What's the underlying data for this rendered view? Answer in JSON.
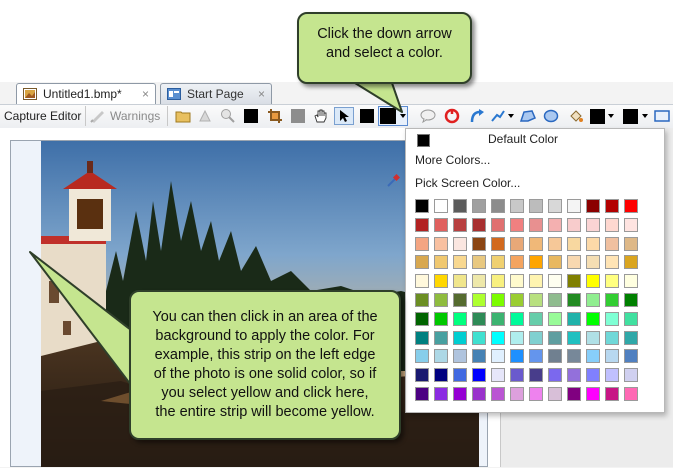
{
  "tabs": [
    {
      "label": "Untitled1.bmp*",
      "close": "×"
    },
    {
      "label": "Start Page",
      "close": "×"
    }
  ],
  "toolbar": {
    "capture_editor": "Capture Editor",
    "warnings": "Warnings",
    "fill_color": "#000000"
  },
  "menu": {
    "default_color": "Default Color",
    "more_colors": "More Colors...",
    "pick_screen_color": "Pick Screen Color..."
  },
  "palette": [
    "#000000",
    "#ffffff",
    "#5c5c5c",
    "#a0a0a0",
    "#8c8c8c",
    "#c8c8c8",
    "#bcbcbc",
    "#d8d8d8",
    "#f4f4f4",
    "#8b0000",
    "#b30000",
    "#ff0000",
    "#b22222",
    "#e0605e",
    "#b84040",
    "#a83030",
    "#e07070",
    "#f08080",
    "#e89090",
    "#f4b0b0",
    "#f8cccc",
    "#fad4d4",
    "#ffd8d0",
    "#ffe4e1",
    "#f4a582",
    "#f8c0a0",
    "#fae6e0",
    "#8b4513",
    "#d2691e",
    "#e8a878",
    "#f0b878",
    "#f6c898",
    "#f8d8a0",
    "#fcd9a8",
    "#f0c0a0",
    "#deb887",
    "#d8a850",
    "#f0c870",
    "#f8d890",
    "#e8c880",
    "#f0d070",
    "#f4a460",
    "#ffa500",
    "#e8b860",
    "#f8d8b0",
    "#f5deb3",
    "#ffe4b5",
    "#daa520",
    "#fff8dc",
    "#ffd700",
    "#f0e68c",
    "#eee8aa",
    "#f8f080",
    "#fffacd",
    "#fff4b0",
    "#fffff0",
    "#808000",
    "#ffff00",
    "#ffff80",
    "#ffffe0",
    "#6b8e23",
    "#8fbc3f",
    "#556b2f",
    "#adff2f",
    "#7cfc00",
    "#9acd32",
    "#b8e080",
    "#8fbc8f",
    "#228b22",
    "#90ee90",
    "#32cd32",
    "#008000",
    "#006400",
    "#00c800",
    "#00ff7f",
    "#2e8b57",
    "#3cb371",
    "#00fa9a",
    "#66cdaa",
    "#98fb98",
    "#20b2aa",
    "#00ff00",
    "#7fffd4",
    "#40e0a0",
    "#008080",
    "#48a0a0",
    "#00ced1",
    "#40e0d0",
    "#00ffff",
    "#afeeee",
    "#80d0d0",
    "#5f9ea0",
    "#20c0c0",
    "#b0e0e6",
    "#70d8d8",
    "#30a8a8",
    "#87ceeb",
    "#add8e6",
    "#b0c4de",
    "#4682b4",
    "#e0f0ff",
    "#1e90ff",
    "#6495ed",
    "#708090",
    "#778899",
    "#87cefa",
    "#b8d8f0",
    "#5080c0",
    "#191970",
    "#000080",
    "#4169e1",
    "#0000ff",
    "#e6e6fa",
    "#6a5acd",
    "#483d8b",
    "#7b68ee",
    "#9370db",
    "#8080ff",
    "#c0c0ff",
    "#d0d0f0",
    "#4b0082",
    "#8a2be2",
    "#9400d3",
    "#9932cc",
    "#ba55d3",
    "#dda0dd",
    "#ee82ee",
    "#d8bfd8",
    "#800080",
    "#ff00ff",
    "#c71585",
    "#ff69b4"
  ],
  "callouts": {
    "top_line1": "Click the down arrow",
    "top_line2": "and select a color.",
    "bottom_lines": [
      "You can then click in an area of the",
      "background to apply the color. For",
      "example, this strip on the left edge",
      "of the photo is one solid color, so if",
      "you select yellow and click here,",
      "the entire strip will become yellow."
    ]
  }
}
